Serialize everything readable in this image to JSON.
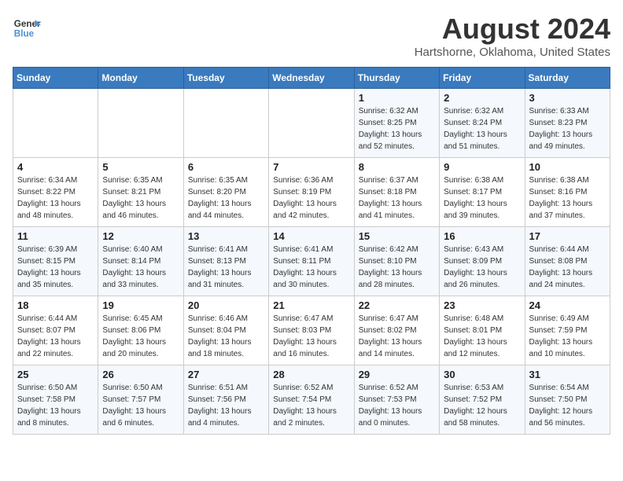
{
  "header": {
    "logo_line1": "General",
    "logo_line2": "Blue",
    "month_year": "August 2024",
    "location": "Hartshorne, Oklahoma, United States"
  },
  "days_of_week": [
    "Sunday",
    "Monday",
    "Tuesday",
    "Wednesday",
    "Thursday",
    "Friday",
    "Saturday"
  ],
  "weeks": [
    [
      {
        "day": "",
        "sunrise": "",
        "sunset": "",
        "daylight": ""
      },
      {
        "day": "",
        "sunrise": "",
        "sunset": "",
        "daylight": ""
      },
      {
        "day": "",
        "sunrise": "",
        "sunset": "",
        "daylight": ""
      },
      {
        "day": "",
        "sunrise": "",
        "sunset": "",
        "daylight": ""
      },
      {
        "day": "1",
        "sunrise": "6:32 AM",
        "sunset": "8:25 PM",
        "daylight": "13 hours and 52 minutes."
      },
      {
        "day": "2",
        "sunrise": "6:32 AM",
        "sunset": "8:24 PM",
        "daylight": "13 hours and 51 minutes."
      },
      {
        "day": "3",
        "sunrise": "6:33 AM",
        "sunset": "8:23 PM",
        "daylight": "13 hours and 49 minutes."
      }
    ],
    [
      {
        "day": "4",
        "sunrise": "6:34 AM",
        "sunset": "8:22 PM",
        "daylight": "13 hours and 48 minutes."
      },
      {
        "day": "5",
        "sunrise": "6:35 AM",
        "sunset": "8:21 PM",
        "daylight": "13 hours and 46 minutes."
      },
      {
        "day": "6",
        "sunrise": "6:35 AM",
        "sunset": "8:20 PM",
        "daylight": "13 hours and 44 minutes."
      },
      {
        "day": "7",
        "sunrise": "6:36 AM",
        "sunset": "8:19 PM",
        "daylight": "13 hours and 42 minutes."
      },
      {
        "day": "8",
        "sunrise": "6:37 AM",
        "sunset": "8:18 PM",
        "daylight": "13 hours and 41 minutes."
      },
      {
        "day": "9",
        "sunrise": "6:38 AM",
        "sunset": "8:17 PM",
        "daylight": "13 hours and 39 minutes."
      },
      {
        "day": "10",
        "sunrise": "6:38 AM",
        "sunset": "8:16 PM",
        "daylight": "13 hours and 37 minutes."
      }
    ],
    [
      {
        "day": "11",
        "sunrise": "6:39 AM",
        "sunset": "8:15 PM",
        "daylight": "13 hours and 35 minutes."
      },
      {
        "day": "12",
        "sunrise": "6:40 AM",
        "sunset": "8:14 PM",
        "daylight": "13 hours and 33 minutes."
      },
      {
        "day": "13",
        "sunrise": "6:41 AM",
        "sunset": "8:13 PM",
        "daylight": "13 hours and 31 minutes."
      },
      {
        "day": "14",
        "sunrise": "6:41 AM",
        "sunset": "8:11 PM",
        "daylight": "13 hours and 30 minutes."
      },
      {
        "day": "15",
        "sunrise": "6:42 AM",
        "sunset": "8:10 PM",
        "daylight": "13 hours and 28 minutes."
      },
      {
        "day": "16",
        "sunrise": "6:43 AM",
        "sunset": "8:09 PM",
        "daylight": "13 hours and 26 minutes."
      },
      {
        "day": "17",
        "sunrise": "6:44 AM",
        "sunset": "8:08 PM",
        "daylight": "13 hours and 24 minutes."
      }
    ],
    [
      {
        "day": "18",
        "sunrise": "6:44 AM",
        "sunset": "8:07 PM",
        "daylight": "13 hours and 22 minutes."
      },
      {
        "day": "19",
        "sunrise": "6:45 AM",
        "sunset": "8:06 PM",
        "daylight": "13 hours and 20 minutes."
      },
      {
        "day": "20",
        "sunrise": "6:46 AM",
        "sunset": "8:04 PM",
        "daylight": "13 hours and 18 minutes."
      },
      {
        "day": "21",
        "sunrise": "6:47 AM",
        "sunset": "8:03 PM",
        "daylight": "13 hours and 16 minutes."
      },
      {
        "day": "22",
        "sunrise": "6:47 AM",
        "sunset": "8:02 PM",
        "daylight": "13 hours and 14 minutes."
      },
      {
        "day": "23",
        "sunrise": "6:48 AM",
        "sunset": "8:01 PM",
        "daylight": "13 hours and 12 minutes."
      },
      {
        "day": "24",
        "sunrise": "6:49 AM",
        "sunset": "7:59 PM",
        "daylight": "13 hours and 10 minutes."
      }
    ],
    [
      {
        "day": "25",
        "sunrise": "6:50 AM",
        "sunset": "7:58 PM",
        "daylight": "13 hours and 8 minutes."
      },
      {
        "day": "26",
        "sunrise": "6:50 AM",
        "sunset": "7:57 PM",
        "daylight": "13 hours and 6 minutes."
      },
      {
        "day": "27",
        "sunrise": "6:51 AM",
        "sunset": "7:56 PM",
        "daylight": "13 hours and 4 minutes."
      },
      {
        "day": "28",
        "sunrise": "6:52 AM",
        "sunset": "7:54 PM",
        "daylight": "13 hours and 2 minutes."
      },
      {
        "day": "29",
        "sunrise": "6:52 AM",
        "sunset": "7:53 PM",
        "daylight": "13 hours and 0 minutes."
      },
      {
        "day": "30",
        "sunrise": "6:53 AM",
        "sunset": "7:52 PM",
        "daylight": "12 hours and 58 minutes."
      },
      {
        "day": "31",
        "sunrise": "6:54 AM",
        "sunset": "7:50 PM",
        "daylight": "12 hours and 56 minutes."
      }
    ]
  ]
}
